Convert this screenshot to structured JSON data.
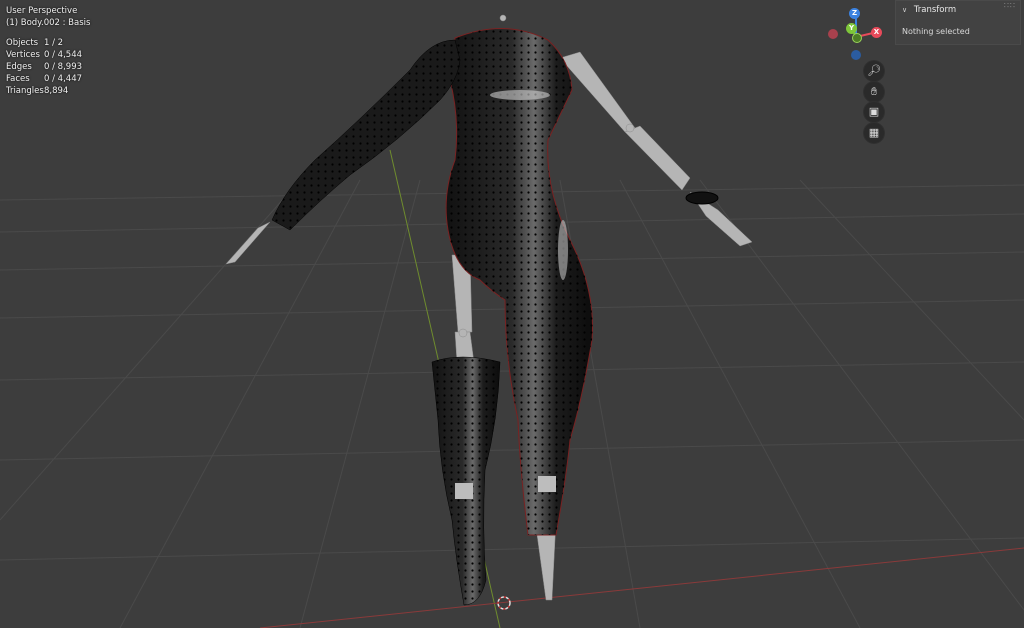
{
  "viewport": {
    "view_name": "User Perspective",
    "object_name": "(1) Body.002 : Basis",
    "stats": [
      {
        "label": "Objects",
        "value": "1 / 2"
      },
      {
        "label": "Vertices",
        "value": "0 / 4,544"
      },
      {
        "label": "Edges",
        "value": "0 / 8,993"
      },
      {
        "label": "Faces",
        "value": "0 / 4,447"
      },
      {
        "label": "Triangles",
        "value": "8,894"
      }
    ]
  },
  "gizmo": {
    "z_label": "Z",
    "y_label": "Y",
    "x_label": "X",
    "colors": {
      "x": "#e84a5a",
      "y": "#7ec63a",
      "z": "#3b82e0"
    }
  },
  "nav_buttons": {
    "zoom_icon": "zoom-icon",
    "pan_icon": "hand-icon",
    "camera_icon": "camera-icon",
    "grid_icon": "grid-icon"
  },
  "transform_panel": {
    "title": "Transform",
    "status": "Nothing selected"
  }
}
